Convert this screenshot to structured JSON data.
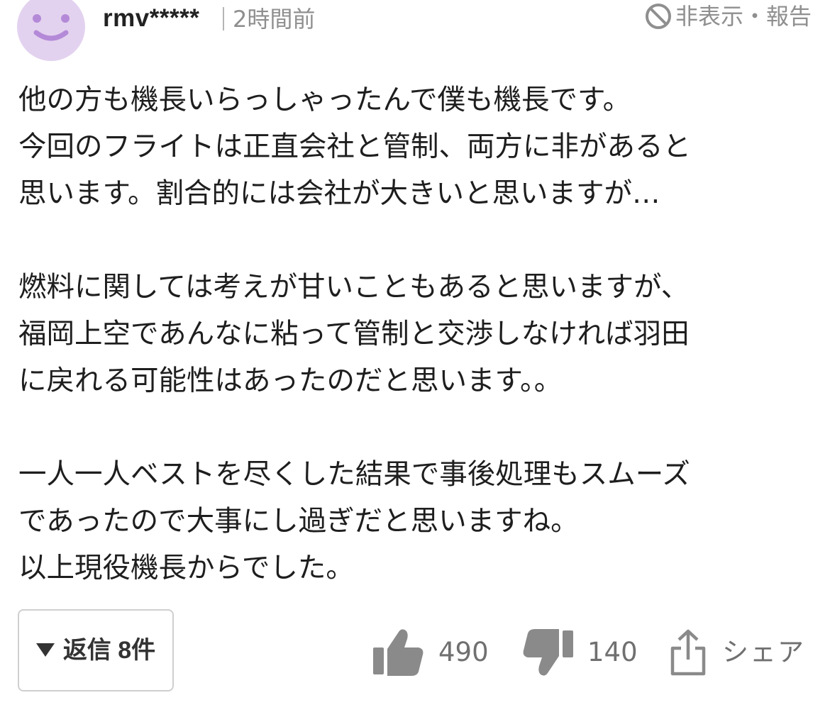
{
  "header": {
    "username": "rmv*****",
    "timestamp": "2時間前",
    "hide_report_label": "非表示・報告"
  },
  "comment": {
    "lines": [
      "他の方も機長いらっしゃったんで僕も機長です。",
      "今回のフライトは正直会社と管制、両方に非があると",
      "思います。割合的には会社が大きいと思いますが…",
      "",
      "燃料に関しては考えが甘いこともあると思いますが、",
      "福岡上空であんなに粘って管制と交渉しなければ羽田",
      "に戻れる可能性はあったのだと思います。。",
      "",
      "一人一人ベストを尽くした結果で事後処理もスムーズ",
      "であったので大事にし過ぎだと思いますね。",
      "以上現役機長からでした。"
    ]
  },
  "footer": {
    "reply_label": "返信 8件",
    "like_count": "490",
    "dislike_count": "140",
    "share_label": "シェア"
  },
  "colors": {
    "avatar_bg": "#e3d2ef",
    "avatar_face": "#b48ad8",
    "muted_text": "#8f8f8f",
    "icon_gray": "#8a8a8a"
  },
  "icons": {
    "avatar": "smiley-face-icon",
    "hide": "prohibited-icon",
    "reply_toggle": "triangle-down-icon",
    "like": "thumbs-up-icon",
    "dislike": "thumbs-down-icon",
    "share": "share-icon"
  }
}
